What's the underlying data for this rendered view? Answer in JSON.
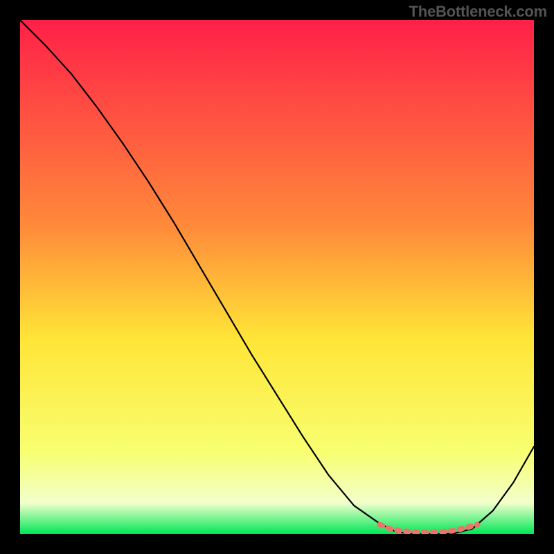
{
  "watermark": "TheBottleneck.com",
  "chart_data": {
    "type": "line",
    "title": "",
    "xlabel": "",
    "ylabel": "",
    "xlim": [
      0,
      100
    ],
    "ylim": [
      0,
      100
    ],
    "gradient_colors": {
      "top": "#ff2048",
      "mid1": "#ff8a3a",
      "mid2": "#ffe537",
      "mid3": "#f8ff70",
      "low": "#f2ffcc",
      "bottom": "#00e756"
    },
    "series": [
      {
        "name": "bottleneck-curve",
        "color": "#000000",
        "x": [
          0,
          5,
          10,
          15,
          20,
          25,
          30,
          35,
          40,
          45,
          50,
          55,
          60,
          65,
          70,
          73,
          76,
          80,
          84,
          88,
          92,
          96,
          100
        ],
        "y": [
          100,
          95,
          89.5,
          83,
          76,
          68.5,
          60.5,
          52,
          43.5,
          35,
          27,
          19,
          11.5,
          5.5,
          2,
          0.5,
          0,
          0,
          0,
          1,
          4.5,
          10,
          17
        ]
      },
      {
        "name": "optimal-range-marker",
        "color": "#e8766b",
        "x": [
          70,
          72,
          74,
          76,
          78,
          80,
          82,
          84,
          86,
          89
        ],
        "y": [
          1.8,
          1.0,
          0.6,
          0.4,
          0.3,
          0.3,
          0.4,
          0.6,
          1.0,
          1.8
        ]
      }
    ]
  }
}
